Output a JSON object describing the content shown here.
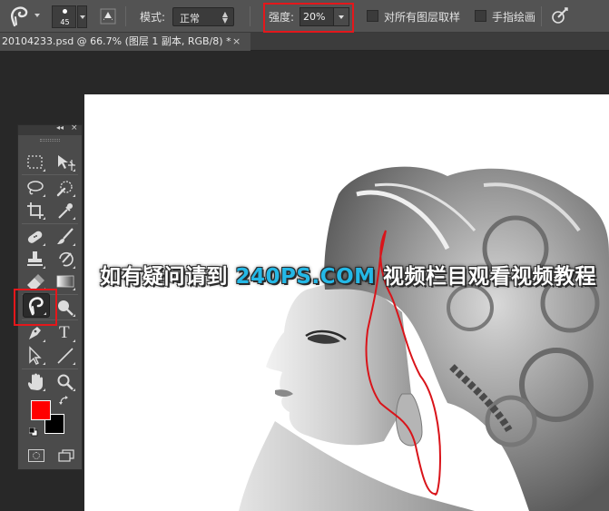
{
  "options_bar": {
    "brush_size": "45",
    "mode_label": "模式:",
    "mode_value": "正常",
    "strength_label": "强度:",
    "strength_value": "20%",
    "sample_all_layers_label": "对所有图层取样",
    "finger_painting_label": "手指绘画",
    "highlight_color": "#e4171b"
  },
  "document_tab": {
    "title": "20104233.psd @ 66.7% (图层 1 副本, RGB/8) *",
    "close_glyph": "×"
  },
  "toolbox": {
    "collapse_glyph": "◂◂",
    "close_glyph": "×",
    "foreground_color": "#ff0000",
    "background_color": "#000000",
    "tools": [
      "rectangular-marquee-icon",
      "move-icon",
      "lasso-icon",
      "quick-selection-icon",
      "crop-icon",
      "eyedropper-icon",
      "healing-brush-icon",
      "brush-icon",
      "clone-stamp-icon",
      "history-brush-icon",
      "eraser-icon",
      "gradient-icon",
      "smudge-icon",
      "dodge-icon",
      "pen-icon",
      "type-icon",
      "path-selection-icon",
      "line-icon",
      "hand-icon",
      "zoom-icon"
    ],
    "active_tool": "smudge-icon",
    "type_glyph": "T"
  },
  "watermark": {
    "prefix": "如有疑问请到 ",
    "site": "240PS.COM",
    "suffix": " 视频栏目观看视频教程",
    "site_color": "#24b8e6"
  }
}
